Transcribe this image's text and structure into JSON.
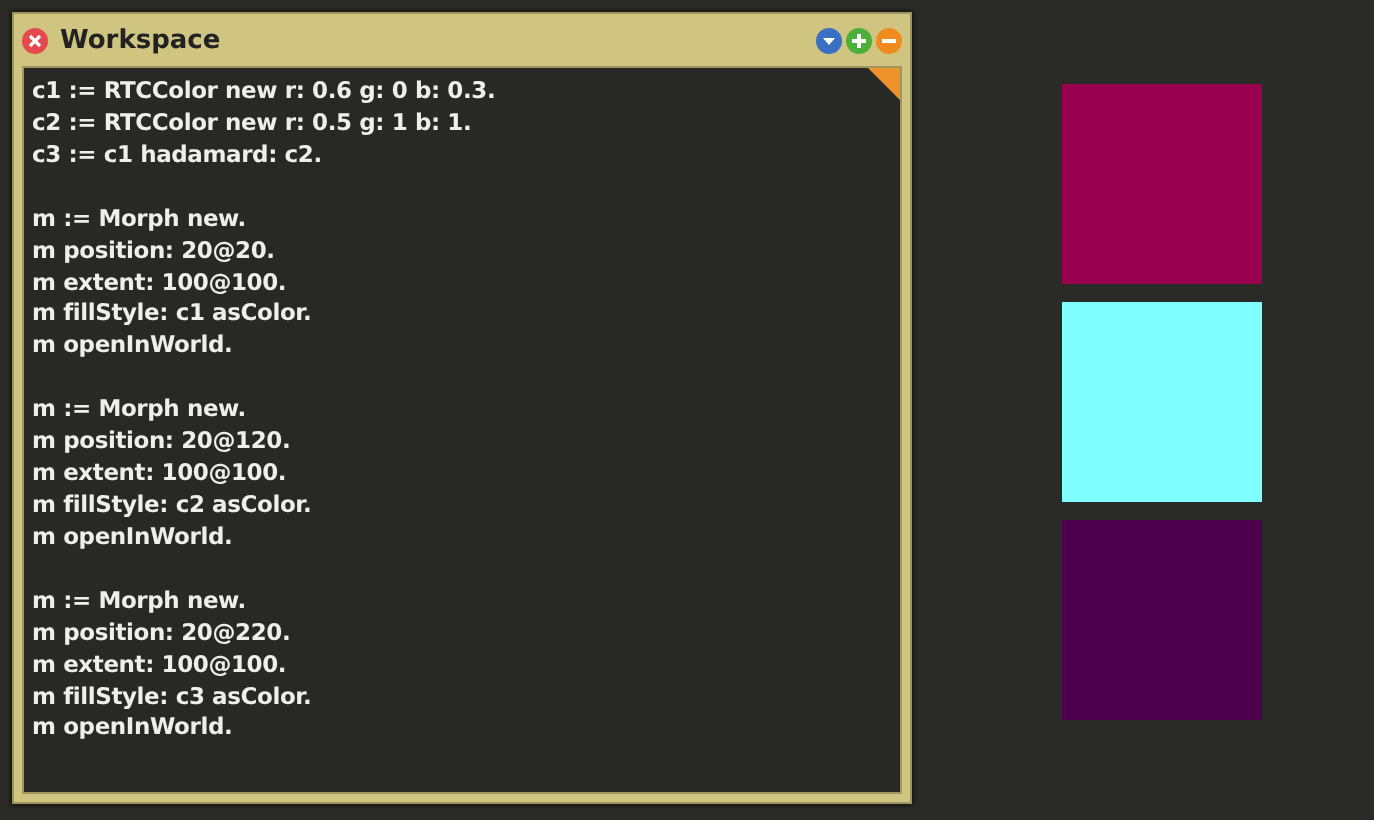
{
  "window": {
    "title": "Workspace"
  },
  "code_blocks": [
    {
      "lines": [
        "c1 := RTCColor new r: 0.6 g: 0 b: 0.3.",
        "c2 := RTCColor new r: 0.5 g: 1 b: 1.",
        "c3 := c1 hadamard: c2."
      ]
    },
    {
      "lines": [
        "m := Morph new.",
        "m position: 20@20.",
        "m extent: 100@100.",
        "m fillStyle: c1 asColor.",
        "m openInWorld."
      ]
    },
    {
      "lines": [
        "m := Morph new.",
        "m position: 20@120.",
        "m extent: 100@100.",
        "m fillStyle: c2 asColor.",
        "m openInWorld."
      ]
    },
    {
      "lines": [
        "m := Morph new.",
        "m position: 20@220.",
        "m extent: 100@100.",
        "m fillStyle: c3 asColor.",
        "m openInWorld."
      ]
    }
  ],
  "morphs": [
    {
      "color": "#99004d"
    },
    {
      "color": "#80ffff"
    },
    {
      "color": "#4d004d"
    }
  ]
}
